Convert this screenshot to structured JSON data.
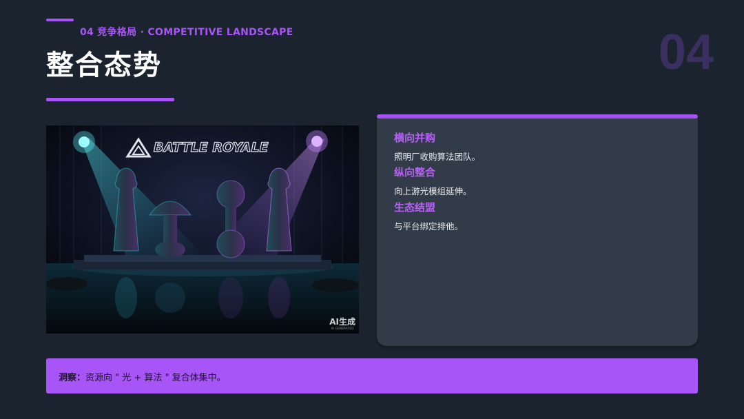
{
  "header": {
    "section_label": "04 竞争格局 · COMPETITIVE LANDSCAPE",
    "title": "整合态势",
    "page_number": "04"
  },
  "hero_image": {
    "sign_text": "BATTLE ROYALE",
    "badge_big": "AI生成",
    "badge_small": "AI GENERATED"
  },
  "card": {
    "items": [
      {
        "title": "横向并购",
        "desc": "照明厂收购算法团队。"
      },
      {
        "title": "纵向整合",
        "desc": "向上游光模组延伸。"
      },
      {
        "title": "生态结盟",
        "desc": "与平台绑定排他。"
      }
    ]
  },
  "insight": {
    "label": "洞察",
    "sep": "：",
    "text": "资源向 \" 光 + 算法 \" 复合体集中。"
  },
  "colors": {
    "background": "#1b232e",
    "accent": "#a855f7",
    "card": "#323c48",
    "page_number": "#3a3060"
  }
}
